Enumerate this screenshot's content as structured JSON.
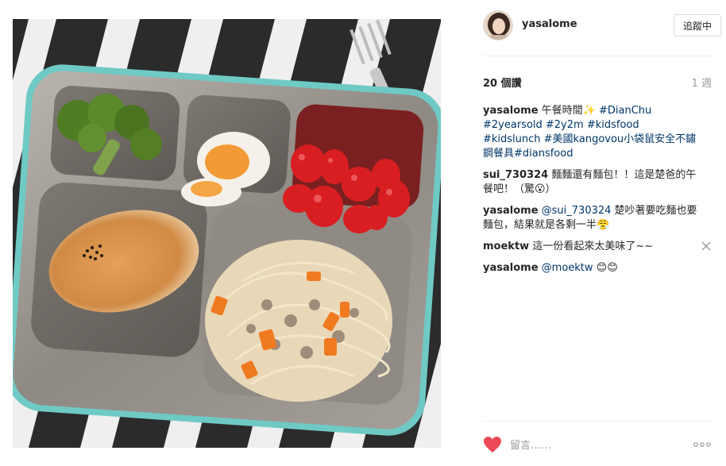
{
  "post": {
    "username": "yasalome",
    "follow_label": "追蹤中",
    "likes": "20 個讚",
    "time": "1 週",
    "comments": [
      {
        "user": "yasalome",
        "text": "午餐時間✨",
        "tags": "#DianChu #2yearsold #2y2m #kidsfood #kidslunch #美國kangovou小袋鼠安全不鏽鋼餐具#diansfood"
      },
      {
        "user": "sui_730324",
        "text": "麵麵還有麵包！！這是楚爸的午餐吧！（驚😮）"
      },
      {
        "user": "yasalome",
        "mention": "@sui_730324",
        "text": "楚吵著要吃麵也要麵包，結果就是各剩一半😤"
      },
      {
        "user": "moektw",
        "text": "這一份看起來太美味了~~"
      },
      {
        "user": "yasalome",
        "mention": "@moektw",
        "text": "😊😊"
      }
    ],
    "comment_placeholder": "留言……"
  },
  "colors": {
    "heart": "#ed4956",
    "link": "#003569",
    "muted": "#999999",
    "border": "#dbdbdb"
  },
  "icons": {
    "like": "heart-icon",
    "more": "more-options-icon",
    "remove": "close-icon"
  }
}
